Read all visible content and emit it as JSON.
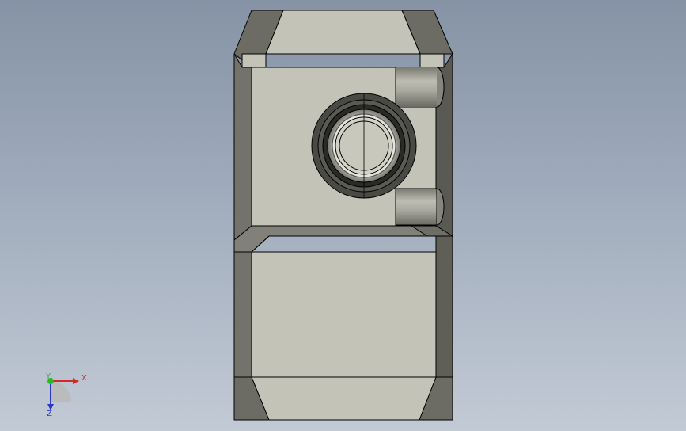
{
  "viewport": {
    "background_top": "#8693a6",
    "background_bottom": "#c2cad5"
  },
  "model": {
    "face_color": "#c3c3b7",
    "side_color": "#73736b",
    "dark_side_color": "#55554f",
    "edge_color": "#000000"
  },
  "triad": {
    "x_label": "X",
    "y_label": "Y",
    "z_label": "Z",
    "x_color": "#d62828",
    "y_color": "#28b828",
    "z_color": "#2838c8"
  }
}
